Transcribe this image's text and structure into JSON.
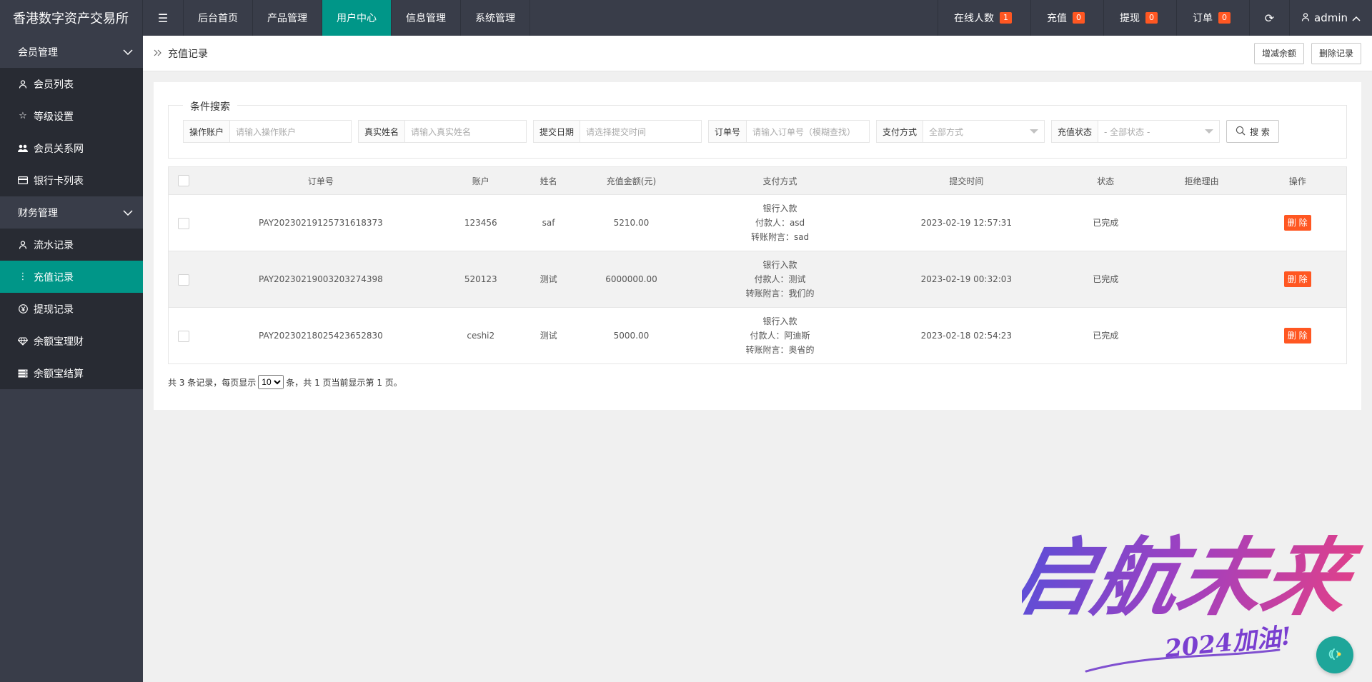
{
  "app": {
    "title": "香港数字资产交易所"
  },
  "topnav": {
    "items": [
      {
        "label": "后台首页"
      },
      {
        "label": "产品管理"
      },
      {
        "label": "用户中心"
      },
      {
        "label": "信息管理"
      },
      {
        "label": "系统管理"
      }
    ],
    "stats": [
      {
        "label": "在线人数",
        "count": "1"
      },
      {
        "label": "充值",
        "count": "0"
      },
      {
        "label": "提现",
        "count": "0"
      },
      {
        "label": "订单",
        "count": "0"
      }
    ],
    "user": "admin"
  },
  "sidebar": {
    "groups": [
      {
        "label": "会员管理",
        "items": [
          {
            "label": "会员列表",
            "icon": "user-icon"
          },
          {
            "label": "等级设置",
            "icon": "star-icon"
          },
          {
            "label": "会员关系网",
            "icon": "users-icon"
          },
          {
            "label": "银行卡列表",
            "icon": "card-icon"
          }
        ]
      },
      {
        "label": "财务管理",
        "items": [
          {
            "label": "流水记录",
            "icon": "user-icon"
          },
          {
            "label": "充值记录",
            "icon": "more-vertical-icon"
          },
          {
            "label": "提现记录",
            "icon": "yen-icon"
          },
          {
            "label": "余额宝理财",
            "icon": "diamond-icon"
          },
          {
            "label": "余额宝结算",
            "icon": "server-icon"
          }
        ]
      }
    ]
  },
  "breadcrumb": {
    "current": "充值记录",
    "actions": [
      "增减余额",
      "删除记录"
    ]
  },
  "search": {
    "legend": "条件搜索",
    "fields": [
      {
        "label": "操作账户",
        "placeholder": "请输入操作账户"
      },
      {
        "label": "真实姓名",
        "placeholder": "请输入真实姓名"
      },
      {
        "label": "提交日期",
        "placeholder": "请选择提交时间"
      },
      {
        "label": "订单号",
        "placeholder": "请输入订单号（模糊查找）"
      },
      {
        "label": "支付方式",
        "placeholder": "全部方式"
      },
      {
        "label": "充值状态",
        "placeholder": "- 全部状态 -"
      }
    ],
    "button": "搜 索"
  },
  "table": {
    "headers": [
      "订单号",
      "账户",
      "姓名",
      "充值金额(元)",
      "支付方式",
      "提交时间",
      "状态",
      "拒绝理由",
      "操作"
    ],
    "rows": [
      {
        "order": "PAY20230219125731618373",
        "account": "123456",
        "name": "saf",
        "amount": "5210.00",
        "pay": [
          "银行入款",
          "付款人：asd",
          "转账附言：sad"
        ],
        "time": "2023-02-19 12:57:31",
        "status": "已完成",
        "reason": "",
        "action": "删 除"
      },
      {
        "order": "PAY20230219003203274398",
        "account": "520123",
        "name": "测试",
        "amount": "6000000.00",
        "pay": [
          "银行入款",
          "付款人：测试",
          "转账附言：我们的"
        ],
        "time": "2023-02-19 00:32:03",
        "status": "已完成",
        "reason": "",
        "action": "删 除"
      },
      {
        "order": "PAY20230218025423652830",
        "account": "ceshi2",
        "name": "测试",
        "amount": "5000.00",
        "pay": [
          "银行入款",
          "付款人：阿迪斯",
          "转账附言：奥省的"
        ],
        "time": "2023-02-18 02:54:23",
        "status": "已完成",
        "reason": "",
        "action": "删 除"
      }
    ]
  },
  "pager": {
    "prefix": "共 3 条记录，每页显示",
    "page_size": "10",
    "suffix": "条，共 1 页当前显示第 1 页。"
  },
  "art": {
    "text": "启航未来",
    "sub": "2024加油!"
  },
  "colors": {
    "accent": "#009688",
    "topbar": "#393d49",
    "badge": "#ff5722",
    "done": "#2ea72e"
  }
}
